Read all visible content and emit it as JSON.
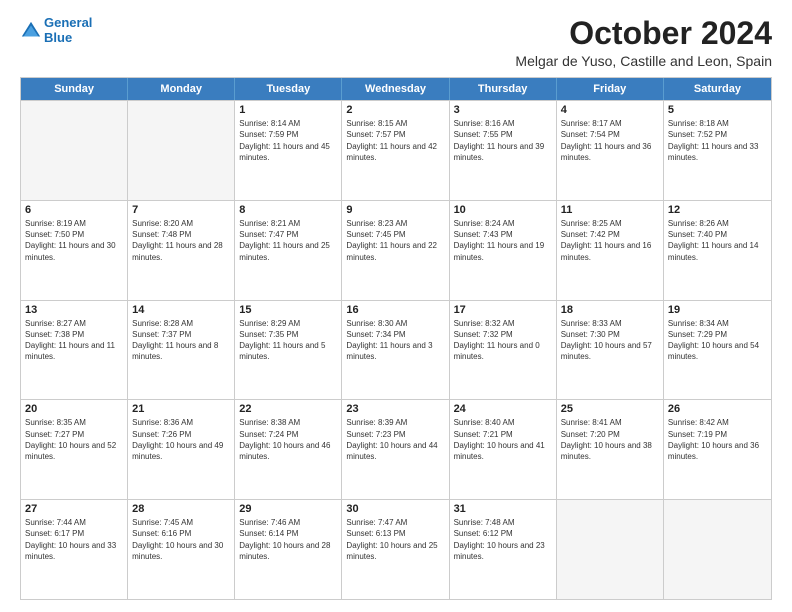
{
  "header": {
    "logo_line1": "General",
    "logo_line2": "Blue",
    "month_title": "October 2024",
    "location": "Melgar de Yuso, Castille and Leon, Spain"
  },
  "weekdays": [
    "Sunday",
    "Monday",
    "Tuesday",
    "Wednesday",
    "Thursday",
    "Friday",
    "Saturday"
  ],
  "rows": [
    [
      {
        "day": "",
        "empty": true
      },
      {
        "day": "",
        "empty": true
      },
      {
        "day": "1",
        "sunrise": "Sunrise: 8:14 AM",
        "sunset": "Sunset: 7:59 PM",
        "daylight": "Daylight: 11 hours and 45 minutes."
      },
      {
        "day": "2",
        "sunrise": "Sunrise: 8:15 AM",
        "sunset": "Sunset: 7:57 PM",
        "daylight": "Daylight: 11 hours and 42 minutes."
      },
      {
        "day": "3",
        "sunrise": "Sunrise: 8:16 AM",
        "sunset": "Sunset: 7:55 PM",
        "daylight": "Daylight: 11 hours and 39 minutes."
      },
      {
        "day": "4",
        "sunrise": "Sunrise: 8:17 AM",
        "sunset": "Sunset: 7:54 PM",
        "daylight": "Daylight: 11 hours and 36 minutes."
      },
      {
        "day": "5",
        "sunrise": "Sunrise: 8:18 AM",
        "sunset": "Sunset: 7:52 PM",
        "daylight": "Daylight: 11 hours and 33 minutes."
      }
    ],
    [
      {
        "day": "6",
        "sunrise": "Sunrise: 8:19 AM",
        "sunset": "Sunset: 7:50 PM",
        "daylight": "Daylight: 11 hours and 30 minutes."
      },
      {
        "day": "7",
        "sunrise": "Sunrise: 8:20 AM",
        "sunset": "Sunset: 7:48 PM",
        "daylight": "Daylight: 11 hours and 28 minutes."
      },
      {
        "day": "8",
        "sunrise": "Sunrise: 8:21 AM",
        "sunset": "Sunset: 7:47 PM",
        "daylight": "Daylight: 11 hours and 25 minutes."
      },
      {
        "day": "9",
        "sunrise": "Sunrise: 8:23 AM",
        "sunset": "Sunset: 7:45 PM",
        "daylight": "Daylight: 11 hours and 22 minutes."
      },
      {
        "day": "10",
        "sunrise": "Sunrise: 8:24 AM",
        "sunset": "Sunset: 7:43 PM",
        "daylight": "Daylight: 11 hours and 19 minutes."
      },
      {
        "day": "11",
        "sunrise": "Sunrise: 8:25 AM",
        "sunset": "Sunset: 7:42 PM",
        "daylight": "Daylight: 11 hours and 16 minutes."
      },
      {
        "day": "12",
        "sunrise": "Sunrise: 8:26 AM",
        "sunset": "Sunset: 7:40 PM",
        "daylight": "Daylight: 11 hours and 14 minutes."
      }
    ],
    [
      {
        "day": "13",
        "sunrise": "Sunrise: 8:27 AM",
        "sunset": "Sunset: 7:38 PM",
        "daylight": "Daylight: 11 hours and 11 minutes."
      },
      {
        "day": "14",
        "sunrise": "Sunrise: 8:28 AM",
        "sunset": "Sunset: 7:37 PM",
        "daylight": "Daylight: 11 hours and 8 minutes."
      },
      {
        "day": "15",
        "sunrise": "Sunrise: 8:29 AM",
        "sunset": "Sunset: 7:35 PM",
        "daylight": "Daylight: 11 hours and 5 minutes."
      },
      {
        "day": "16",
        "sunrise": "Sunrise: 8:30 AM",
        "sunset": "Sunset: 7:34 PM",
        "daylight": "Daylight: 11 hours and 3 minutes."
      },
      {
        "day": "17",
        "sunrise": "Sunrise: 8:32 AM",
        "sunset": "Sunset: 7:32 PM",
        "daylight": "Daylight: 11 hours and 0 minutes."
      },
      {
        "day": "18",
        "sunrise": "Sunrise: 8:33 AM",
        "sunset": "Sunset: 7:30 PM",
        "daylight": "Daylight: 10 hours and 57 minutes."
      },
      {
        "day": "19",
        "sunrise": "Sunrise: 8:34 AM",
        "sunset": "Sunset: 7:29 PM",
        "daylight": "Daylight: 10 hours and 54 minutes."
      }
    ],
    [
      {
        "day": "20",
        "sunrise": "Sunrise: 8:35 AM",
        "sunset": "Sunset: 7:27 PM",
        "daylight": "Daylight: 10 hours and 52 minutes."
      },
      {
        "day": "21",
        "sunrise": "Sunrise: 8:36 AM",
        "sunset": "Sunset: 7:26 PM",
        "daylight": "Daylight: 10 hours and 49 minutes."
      },
      {
        "day": "22",
        "sunrise": "Sunrise: 8:38 AM",
        "sunset": "Sunset: 7:24 PM",
        "daylight": "Daylight: 10 hours and 46 minutes."
      },
      {
        "day": "23",
        "sunrise": "Sunrise: 8:39 AM",
        "sunset": "Sunset: 7:23 PM",
        "daylight": "Daylight: 10 hours and 44 minutes."
      },
      {
        "day": "24",
        "sunrise": "Sunrise: 8:40 AM",
        "sunset": "Sunset: 7:21 PM",
        "daylight": "Daylight: 10 hours and 41 minutes."
      },
      {
        "day": "25",
        "sunrise": "Sunrise: 8:41 AM",
        "sunset": "Sunset: 7:20 PM",
        "daylight": "Daylight: 10 hours and 38 minutes."
      },
      {
        "day": "26",
        "sunrise": "Sunrise: 8:42 AM",
        "sunset": "Sunset: 7:19 PM",
        "daylight": "Daylight: 10 hours and 36 minutes."
      }
    ],
    [
      {
        "day": "27",
        "sunrise": "Sunrise: 7:44 AM",
        "sunset": "Sunset: 6:17 PM",
        "daylight": "Daylight: 10 hours and 33 minutes."
      },
      {
        "day": "28",
        "sunrise": "Sunrise: 7:45 AM",
        "sunset": "Sunset: 6:16 PM",
        "daylight": "Daylight: 10 hours and 30 minutes."
      },
      {
        "day": "29",
        "sunrise": "Sunrise: 7:46 AM",
        "sunset": "Sunset: 6:14 PM",
        "daylight": "Daylight: 10 hours and 28 minutes."
      },
      {
        "day": "30",
        "sunrise": "Sunrise: 7:47 AM",
        "sunset": "Sunset: 6:13 PM",
        "daylight": "Daylight: 10 hours and 25 minutes."
      },
      {
        "day": "31",
        "sunrise": "Sunrise: 7:48 AM",
        "sunset": "Sunset: 6:12 PM",
        "daylight": "Daylight: 10 hours and 23 minutes."
      },
      {
        "day": "",
        "empty": true
      },
      {
        "day": "",
        "empty": true
      }
    ]
  ]
}
